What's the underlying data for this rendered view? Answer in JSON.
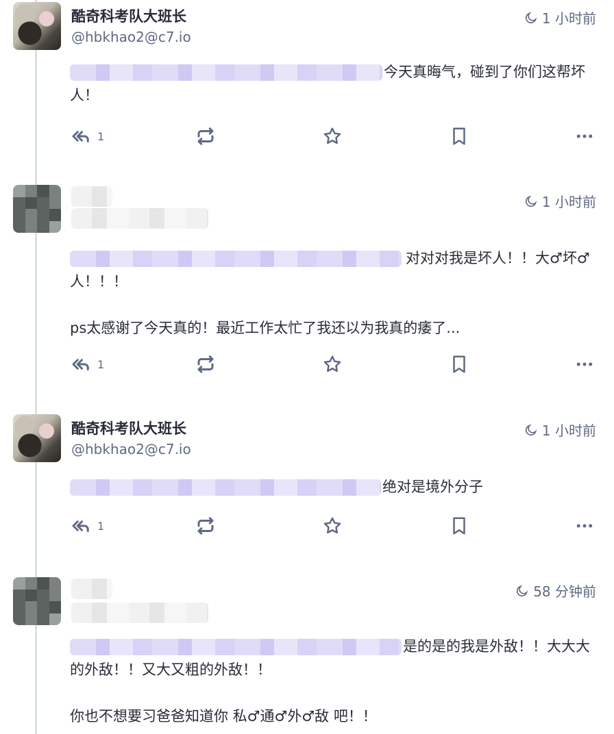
{
  "statuses": [
    {
      "name": "酷奇科考队大班长",
      "handle": "@hbkhao2@c7.io",
      "time": "1 小时前",
      "paragraphs": [
        "今天真晦气，碰到了你们这帮坏人！"
      ],
      "reply_count": "1"
    },
    {
      "name": "",
      "handle": "",
      "time": "1 小时前",
      "paragraphs": [
        "对对对我是坏人！！大♂坏♂人！！！",
        "ps太感谢了今天真的！最近工作太忙了我还以为我真的痿了..."
      ],
      "reply_count": "1"
    },
    {
      "name": "酷奇科考队大班长",
      "handle": "@hbkhao2@c7.io",
      "time": "1 小时前",
      "paragraphs": [
        "绝对是境外分子"
      ],
      "reply_count": "1"
    },
    {
      "name": "",
      "handle": "",
      "time": "58 分钟前",
      "paragraphs": [
        "是的是的我是外敌！！大大大的外敌！！又大又粗的外敌！！",
        "你也不想要习爸爸知道你 私♂通♂外♂敌 吧！！"
      ],
      "reply_count": ""
    }
  ],
  "icons": {
    "time": "moon-icon",
    "reply": "reply-all-icon",
    "boost": "retweet-icon",
    "favourite": "star-icon",
    "bookmark": "bookmark-icon",
    "more": "ellipsis-icon"
  },
  "colors": {
    "text": "#282c37",
    "secondary": "#606984",
    "thread_line": "#d9e1e8",
    "redaction": "#d8d2f6"
  }
}
